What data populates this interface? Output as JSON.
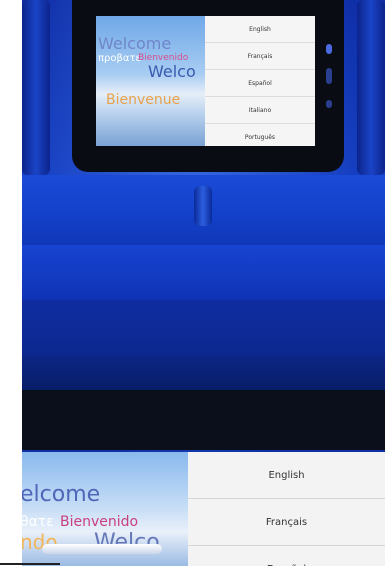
{
  "languages": [
    "English",
    "Français",
    "Español",
    "Italiano",
    "Português"
  ],
  "zoom_languages": [
    "English",
    "Français",
    "Español"
  ],
  "welcome_words": {
    "welcome": "Welcome",
    "greek": "προβατε",
    "bienvenido": "Bienvenido",
    "welco": "Welco",
    "bienvenue": "Bienvenue",
    "elcome": "elcome",
    "zoom_greek": "θατε",
    "zoom_bienvenido": "Bienvenido",
    "ndo": "ndo",
    "zoom_welco": "Welco"
  },
  "colors": {
    "seat_blue": "#1641c4",
    "menu_bg": "#f5f5f5"
  }
}
